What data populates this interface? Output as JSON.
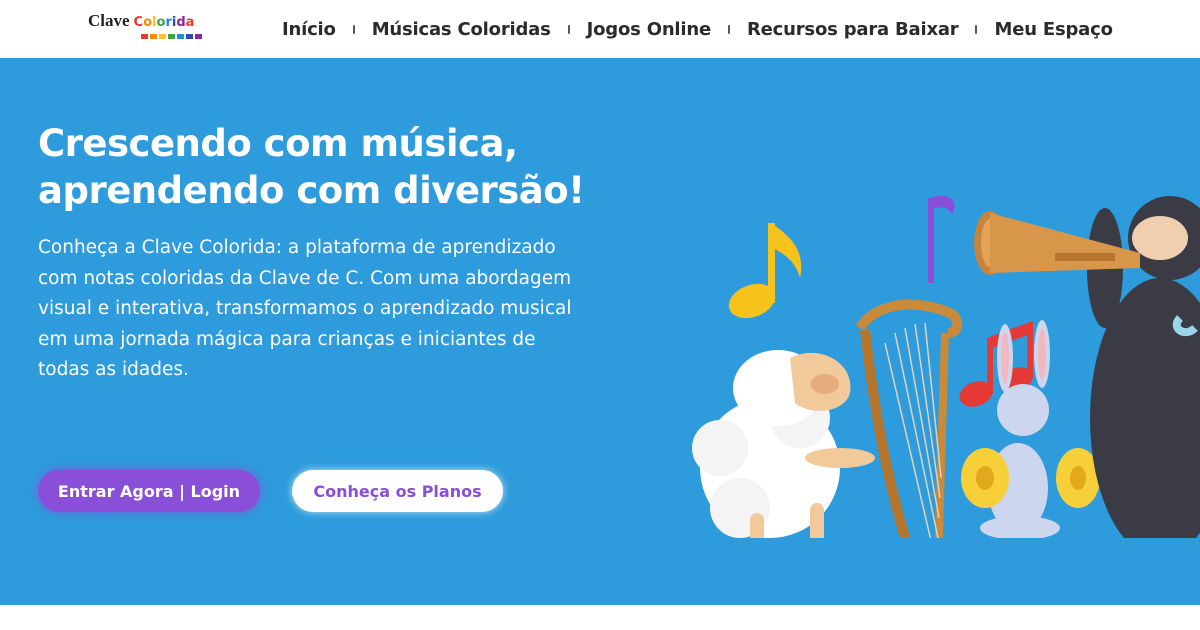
{
  "logo": {
    "main": "Clave",
    "accent_letters": [
      "C",
      "o",
      "l",
      "o",
      "r",
      "i",
      "d",
      "a"
    ],
    "accent_colors": [
      "#e53935",
      "#fb8c00",
      "#fbc02d",
      "#43a047",
      "#1e88e5",
      "#3949ab",
      "#8e24aa",
      "#e53935"
    ],
    "bar_colors": [
      "#e53935",
      "#fb8c00",
      "#fbc02d",
      "#43a047",
      "#1e88e5",
      "#3949ab",
      "#8e24aa"
    ]
  },
  "nav": {
    "items": [
      {
        "label": "Início"
      },
      {
        "label": "Músicas Coloridas"
      },
      {
        "label": "Jogos Online"
      },
      {
        "label": "Recursos para Baixar"
      },
      {
        "label": "Meu Espaço"
      }
    ]
  },
  "hero": {
    "title_line1": "Crescendo com música,",
    "title_line2": "aprendendo com diversão!",
    "description": "Conheça a Clave Colorida: a plataforma de aprendizado com notas coloridas da Clave de C. Com uma abordagem visual e interativa, transformamos o aprendizado musical em uma jornada mágica para crianças e iniciantes de todas as idades.",
    "primary_button": "Entrar Agora | Login",
    "secondary_button": "Conheça os Planos",
    "background_color": "#2e9bdc",
    "primary_color": "#8a4fd8"
  }
}
